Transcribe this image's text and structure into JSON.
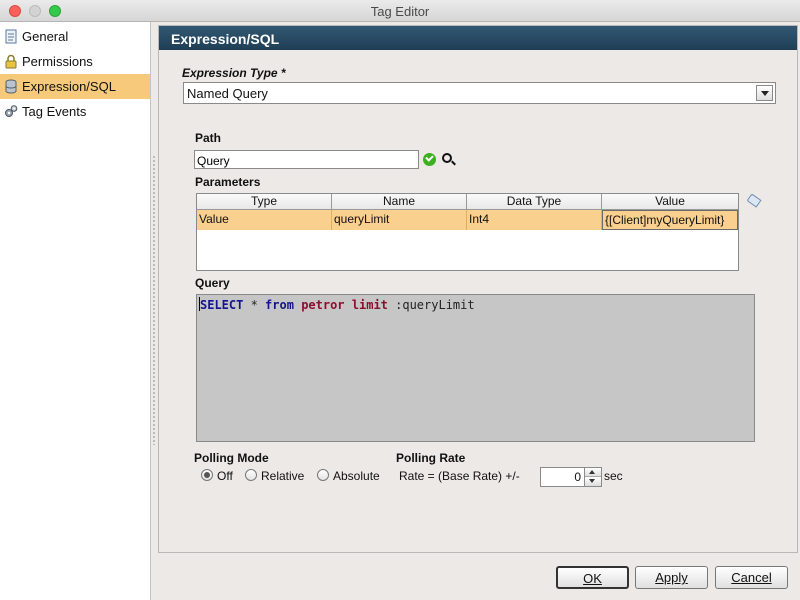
{
  "window": {
    "title": "Tag Editor"
  },
  "sidebar": {
    "items": [
      {
        "label": "General",
        "icon": "document-icon"
      },
      {
        "label": "Permissions",
        "icon": "lock-icon"
      },
      {
        "label": "Expression/SQL",
        "icon": "database-icon",
        "active": true
      },
      {
        "label": "Tag Events",
        "icon": "gears-icon"
      }
    ]
  },
  "panel": {
    "header": "Expression/SQL",
    "expression_type": {
      "label": "Expression Type *",
      "value": "Named Query"
    },
    "path": {
      "label": "Path",
      "value": "Query"
    },
    "parameters": {
      "label": "Parameters",
      "columns": [
        "Type",
        "Name",
        "Data Type",
        "Value"
      ],
      "rows": [
        {
          "type": "Value",
          "name": "queryLimit",
          "data_type": "Int4",
          "value": "{[Client]myQueryLimit}"
        }
      ]
    },
    "query": {
      "label": "Query",
      "tokens": {
        "select": "SELECT",
        "star": " * ",
        "from": "from",
        "sp1": " ",
        "table": "petror",
        "sp2": " ",
        "limit": "limit",
        "param": " :queryLimit"
      }
    },
    "polling_mode": {
      "label": "Polling Mode",
      "options": [
        "Off",
        "Relative",
        "Absolute"
      ],
      "selected": "Off"
    },
    "polling_rate": {
      "label": "Polling Rate",
      "prefix": "Rate = (Base Rate) +/-",
      "value": "0",
      "suffix": "sec"
    }
  },
  "buttons": {
    "ok": "OK",
    "apply": "Apply",
    "cancel": "Cancel"
  },
  "colors": {
    "header": "#2a4b63",
    "selection": "#f7c97a",
    "accent_check": "#3cb01f"
  }
}
